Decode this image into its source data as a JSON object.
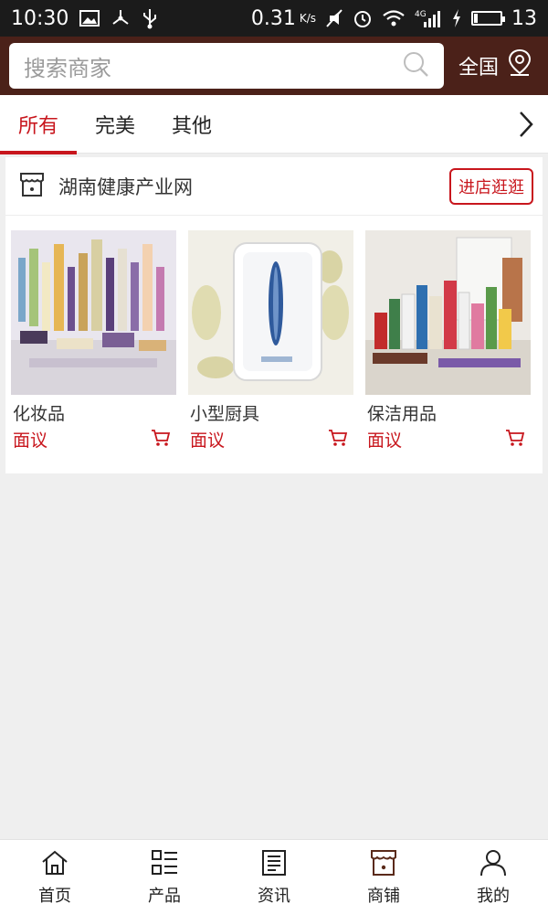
{
  "status_bar": {
    "time": "10:30",
    "speed": "0.31",
    "speed_unit": "K/s",
    "network": "4G",
    "battery": "13",
    "battery_fraction": 0.13
  },
  "header": {
    "search_placeholder": "搜索商家",
    "region_label": "全国"
  },
  "tabs": [
    {
      "label": "所有",
      "active": true
    },
    {
      "label": "完美",
      "active": false
    },
    {
      "label": "其他",
      "active": false
    }
  ],
  "shop": {
    "name": "湖南健康产业网",
    "enter_label": "进店逛逛",
    "products": [
      {
        "name": "化妆品",
        "price": "面议"
      },
      {
        "name": "小型厨具",
        "price": "面议"
      },
      {
        "name": "保洁用品",
        "price": "面议"
      }
    ]
  },
  "bottom_nav": [
    {
      "label": "首页",
      "icon": "home-icon"
    },
    {
      "label": "产品",
      "icon": "list-icon"
    },
    {
      "label": "资讯",
      "icon": "news-icon"
    },
    {
      "label": "商铺",
      "icon": "shop-icon"
    },
    {
      "label": "我的",
      "icon": "user-icon"
    }
  ],
  "colors": {
    "header_bg": "#4b2119",
    "accent": "#c8161d",
    "page_bg": "#efefef"
  }
}
